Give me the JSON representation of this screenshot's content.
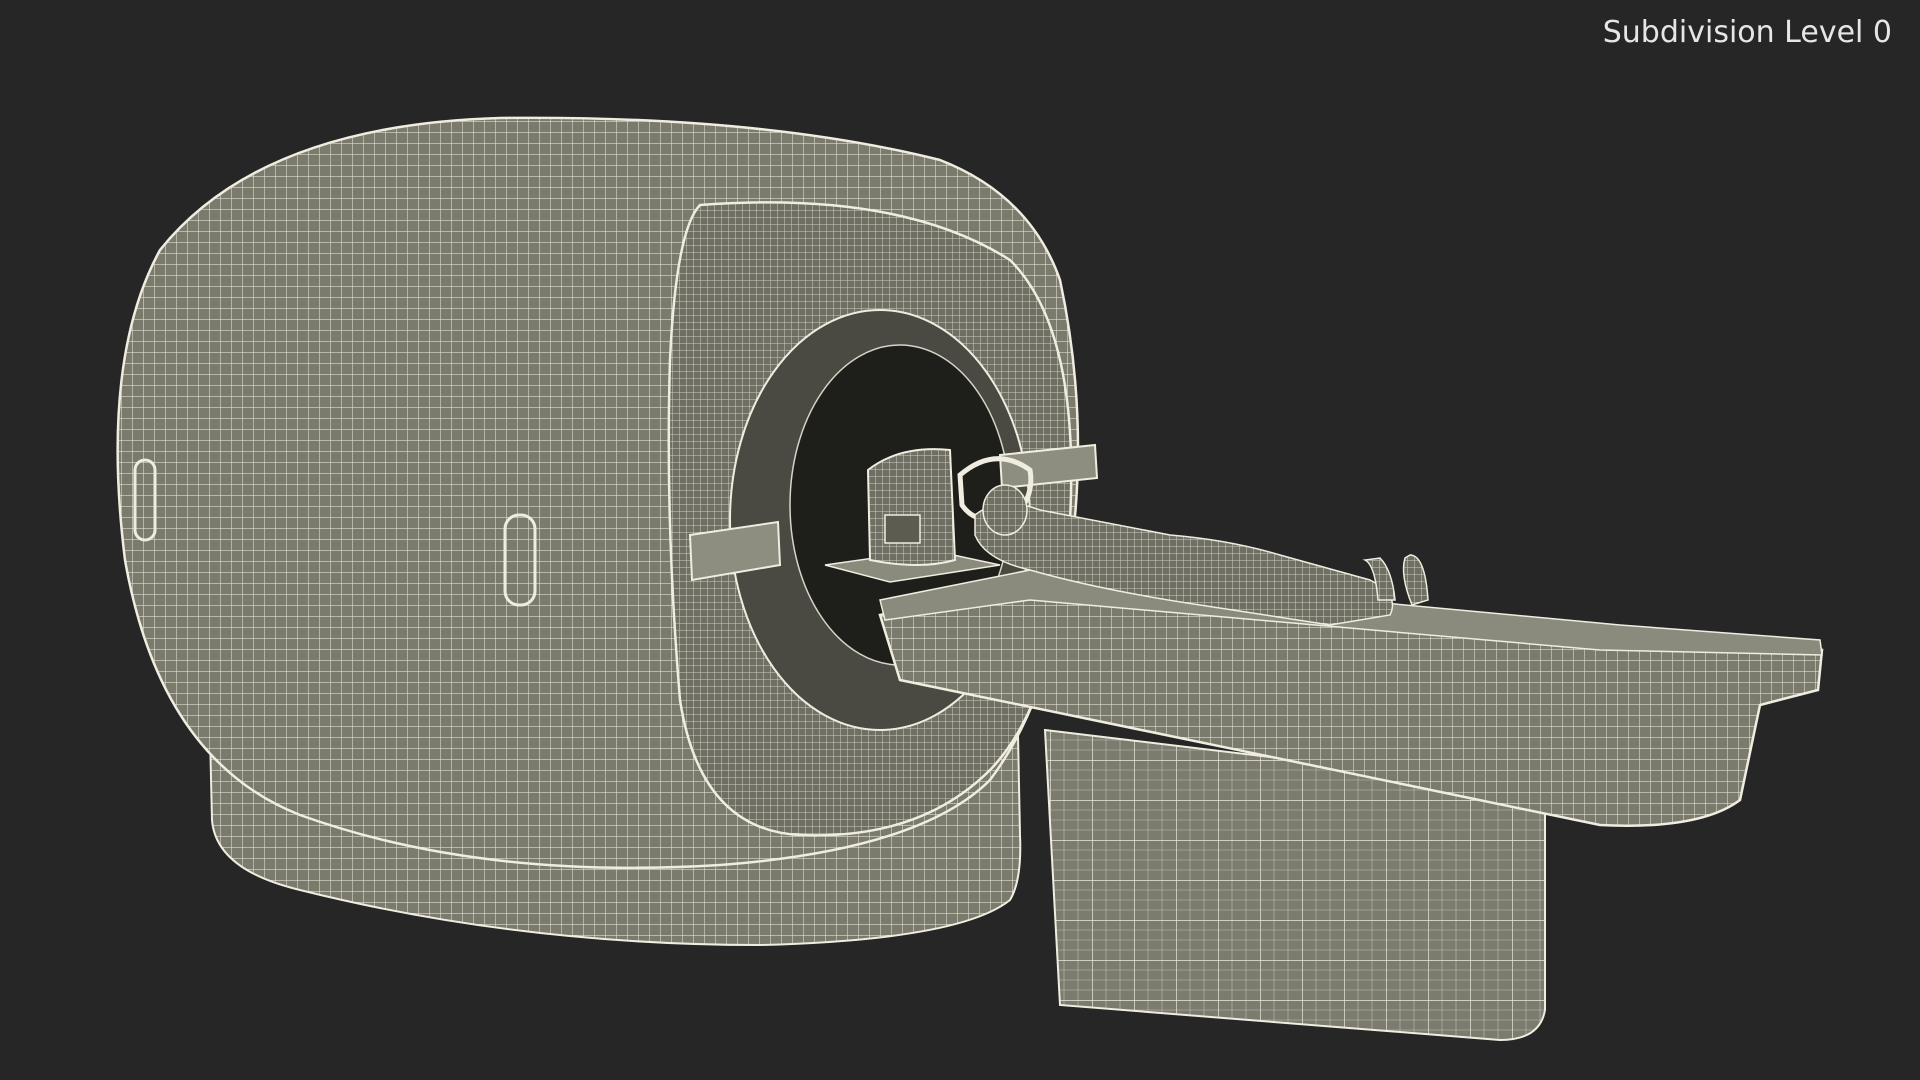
{
  "viewport": {
    "label": "Subdivision Level 0",
    "background": "#262626",
    "mesh_fill": "#7a7a6d",
    "wire_color": "#f0ede0"
  },
  "scene": {
    "objects": [
      "mri-gantry",
      "patient-table",
      "patient-figure",
      "head-coil"
    ]
  }
}
